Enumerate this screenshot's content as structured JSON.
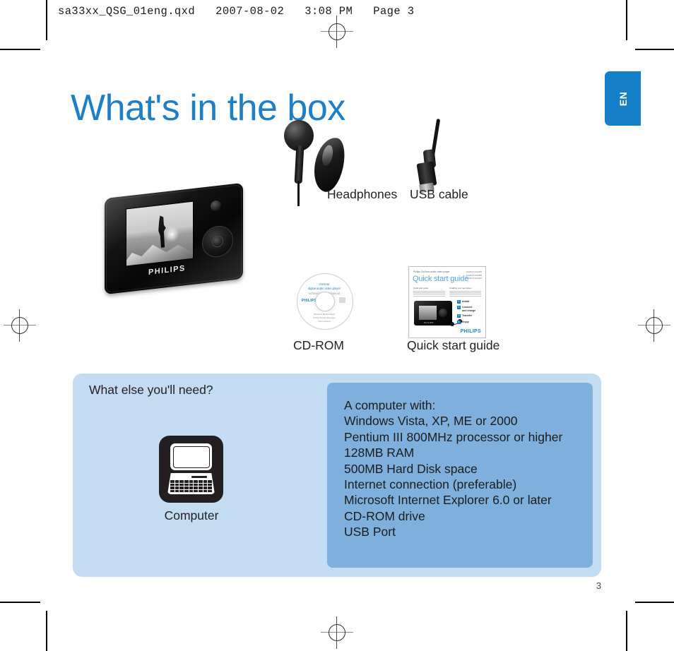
{
  "document": {
    "slug": "sa33xx_QSG_01eng.qxd   2007-08-02   3:08 PM   Page 3",
    "page_number": "3",
    "language_tab": "EN",
    "title": "What's in the box",
    "accent_color": "#1f7ec4",
    "tab_color": "#1580c9",
    "panel_color": "#c3dcf2",
    "panel_inner_color": "#7fb0dd"
  },
  "box_contents": [
    {
      "name": "player",
      "label": ""
    },
    {
      "name": "headphones",
      "label": "Headphones"
    },
    {
      "name": "usb-cable",
      "label": "USB cable"
    },
    {
      "name": "cd-rom",
      "label": "CD-ROM"
    },
    {
      "name": "quick-start-guide",
      "label": "Quick start guide"
    }
  ],
  "player": {
    "brand": "PHILIPS"
  },
  "cd": {
    "title_line1": "GoGear",
    "title_line2": "digital audio video player",
    "title_line3": "software & user manual",
    "brand": "PHILIPS",
    "footer_line1": "Windows Media Player",
    "footer_line2": "Philips Device Manager",
    "footer_line3": "User manual"
  },
  "quick_start_guide": {
    "eyebrow": "Philips GoGear audio video player",
    "title": "Quick start guide",
    "models": "SA3315 SA3325\nSA3345 SA3385\nSA3415 SA3425",
    "col1_heading": "Quick start guide",
    "col2_heading": "Installing your new player",
    "steps": [
      {
        "num": "1",
        "label": "Install"
      },
      {
        "num": "2",
        "label": "Connect\nand charge"
      },
      {
        "num": "3",
        "label": "Transfer"
      },
      {
        "num": "4",
        "label": "Enjoy"
      }
    ],
    "brand": "PHILIPS",
    "device_brand": "PHILIPS"
  },
  "requirements": {
    "heading": "What else you'll need?",
    "icon_label": "Computer",
    "lines": [
      "A computer with:",
      "Windows Vista, XP, ME or 2000",
      "Pentium III 800MHz processor or higher",
      "128MB RAM",
      "500MB Hard Disk space",
      "Internet connection (preferable)",
      "Microsoft Internet Explorer 6.0 or later",
      "CD-ROM drive",
      "USB Port"
    ]
  }
}
